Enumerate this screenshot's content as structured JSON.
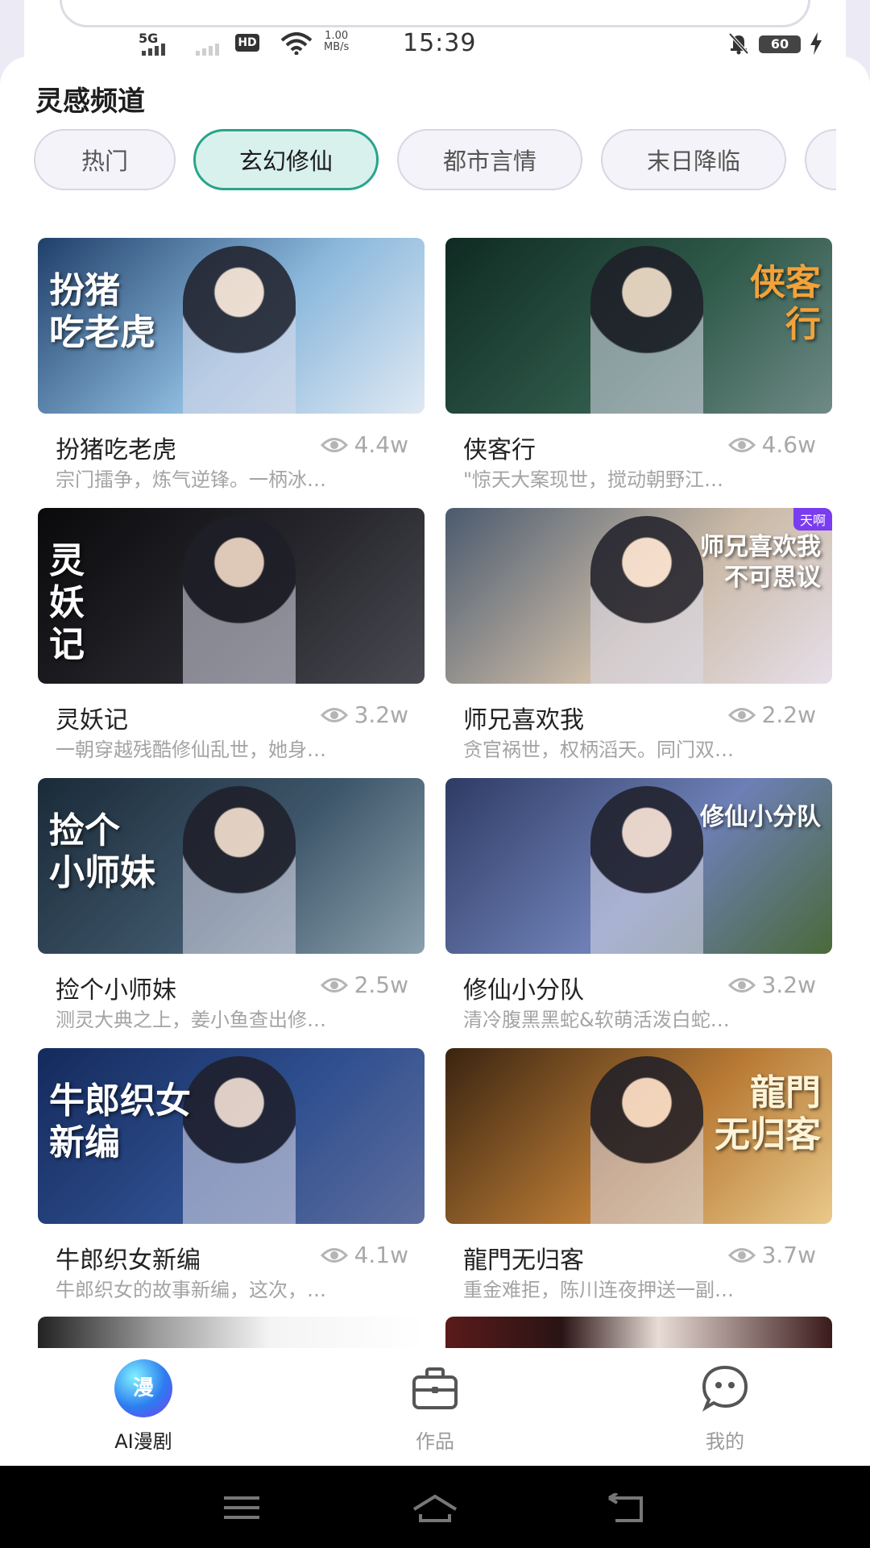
{
  "status": {
    "network": "5G",
    "hd": "HD",
    "speed_value": "1.00",
    "speed_unit": "MB/s",
    "time": "15:39",
    "battery": "60"
  },
  "channel": {
    "title": "灵感频道",
    "tabs": [
      {
        "label": "热门",
        "active": false
      },
      {
        "label": "玄幻修仙",
        "active": true
      },
      {
        "label": "都市言情",
        "active": false
      },
      {
        "label": "末日降临",
        "active": false
      }
    ]
  },
  "cards": [
    {
      "title": "扮猪吃老虎",
      "views": "4.4w",
      "desc": "宗门擂争，炼气逆锋。一柄冰…",
      "thumb_text": "扮猪\n吃老虎",
      "colors": [
        "#1f3f6a",
        "#8bb8dc",
        "#dfe9f3"
      ]
    },
    {
      "title": "侠客行",
      "views": "4.6w",
      "desc": "\"惊天大案现世，搅动朝野江…",
      "thumb_text": "侠客\n行",
      "colors": [
        "#0f2a22",
        "#2f5a4a",
        "#6f8a86"
      ]
    },
    {
      "title": "灵妖记",
      "views": "3.2w",
      "desc": "一朝穿越残酷修仙乱世，她身…",
      "thumb_text": "灵\n妖\n记",
      "colors": [
        "#0a0a0c",
        "#26262c",
        "#4a4a52"
      ]
    },
    {
      "title": "师兄喜欢我",
      "views": "2.2w",
      "desc": "贪官祸世，权柄滔天。同门双…",
      "thumb_text": "师兄喜欢我\n不可思议",
      "colors": [
        "#4a5a6e",
        "#c9b9a6",
        "#e7dfe9"
      ]
    },
    {
      "title": "捡个小师妹",
      "views": "2.5w",
      "desc": "测灵大典之上，姜小鱼查出修…",
      "thumb_text": "捡个\n小师妹",
      "colors": [
        "#1a2a38",
        "#3e566a",
        "#8aa0ad"
      ]
    },
    {
      "title": "修仙小分队",
      "views": "3.2w",
      "desc": "清冷腹黑黑蛇&软萌活泼白蛇…",
      "thumb_text": "修仙小分队",
      "colors": [
        "#2e3b64",
        "#6d7fb5",
        "#4a6a3a"
      ]
    },
    {
      "title": "牛郎织女新编",
      "views": "4.1w",
      "desc": "牛郎织女的故事新编，这次，…",
      "thumb_text": "牛郎织女\n新编",
      "colors": [
        "#142a5c",
        "#2f4f8f",
        "#5e6e9e"
      ]
    },
    {
      "title": "龍門无归客",
      "views": "3.7w",
      "desc": "重金难拒，陈川连夜押送一副…",
      "thumb_text": "龍門\n无归客",
      "colors": [
        "#3a2410",
        "#b87a35",
        "#e9c98a"
      ]
    }
  ],
  "peek_cards": [
    {
      "colors": [
        "#e9e9e9",
        "#ffffff"
      ]
    },
    {
      "colors": [
        "#3a1a1a",
        "#f0e6e0"
      ]
    }
  ],
  "thumb_badge": "天啊",
  "nav": {
    "items": [
      {
        "label": "AI漫剧",
        "icon": "漫",
        "active": true
      },
      {
        "label": "作品",
        "icon": "briefcase-icon",
        "active": false
      },
      {
        "label": "我的",
        "icon": "chat-face-icon",
        "active": false
      }
    ]
  }
}
